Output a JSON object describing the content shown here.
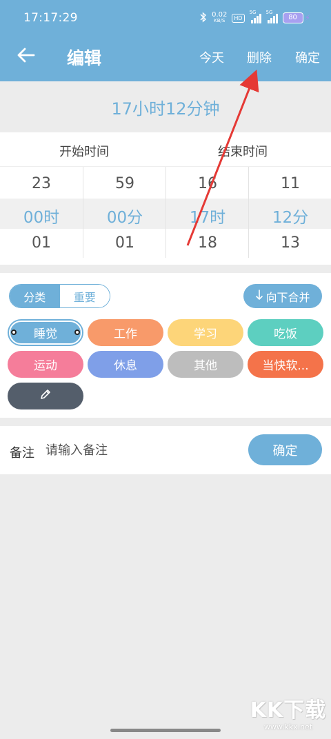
{
  "status_bar": {
    "time": "17:17:29",
    "net_speed_value": "0.02",
    "net_speed_unit": "KB/S",
    "hd_label": "HD",
    "signal1_label": "5G",
    "signal2_label": "5G",
    "battery_level": "80",
    "icons": [
      "bluetooth-icon",
      "signal-icon",
      "signal-icon",
      "battery-icon",
      "charging-icon"
    ]
  },
  "toolbar": {
    "title": "编辑",
    "today_label": "今天",
    "delete_label": "删除",
    "confirm_label": "确定"
  },
  "duration_text": "17小时12分钟",
  "picker": {
    "start_label": "开始时间",
    "end_label": "结束时间",
    "columns": [
      {
        "prev": "23",
        "current": "00时",
        "next": "01"
      },
      {
        "prev": "59",
        "current": "00分",
        "next": "01"
      },
      {
        "prev": "16",
        "current": "17时",
        "next": "18"
      },
      {
        "prev": "11",
        "current": "12分",
        "next": "13"
      }
    ]
  },
  "categories": {
    "tabs": [
      {
        "label": "分类",
        "active": true
      },
      {
        "label": "重要",
        "active": false
      }
    ],
    "merge_label": "向下合并",
    "merge_icon": "down-arrow-icon",
    "items": [
      {
        "label": "睡觉",
        "color": "#6fb0d9",
        "selected": true
      },
      {
        "label": "工作",
        "color": "#f89a6a",
        "selected": false
      },
      {
        "label": "学习",
        "color": "#fdd579",
        "selected": false
      },
      {
        "label": "吃饭",
        "color": "#5dcfc0",
        "selected": false
      },
      {
        "label": "运动",
        "color": "#f57d9a",
        "selected": false
      },
      {
        "label": "休息",
        "color": "#7f9fe8",
        "selected": false
      },
      {
        "label": "其他",
        "color": "#bdbdbd",
        "selected": false
      },
      {
        "label": "当快软...",
        "color": "#f4734a",
        "selected": false
      }
    ],
    "edit_icon": "pencil-icon",
    "edit_color": "#545e6b"
  },
  "note": {
    "label": "备注",
    "placeholder": "请输入备注",
    "confirm_label": "确定"
  },
  "watermark": {
    "brand": "KK下载",
    "url": "www.kkx.net"
  },
  "colors": {
    "accent": "#6fb0d9",
    "annotation_arrow": "#e53935"
  }
}
